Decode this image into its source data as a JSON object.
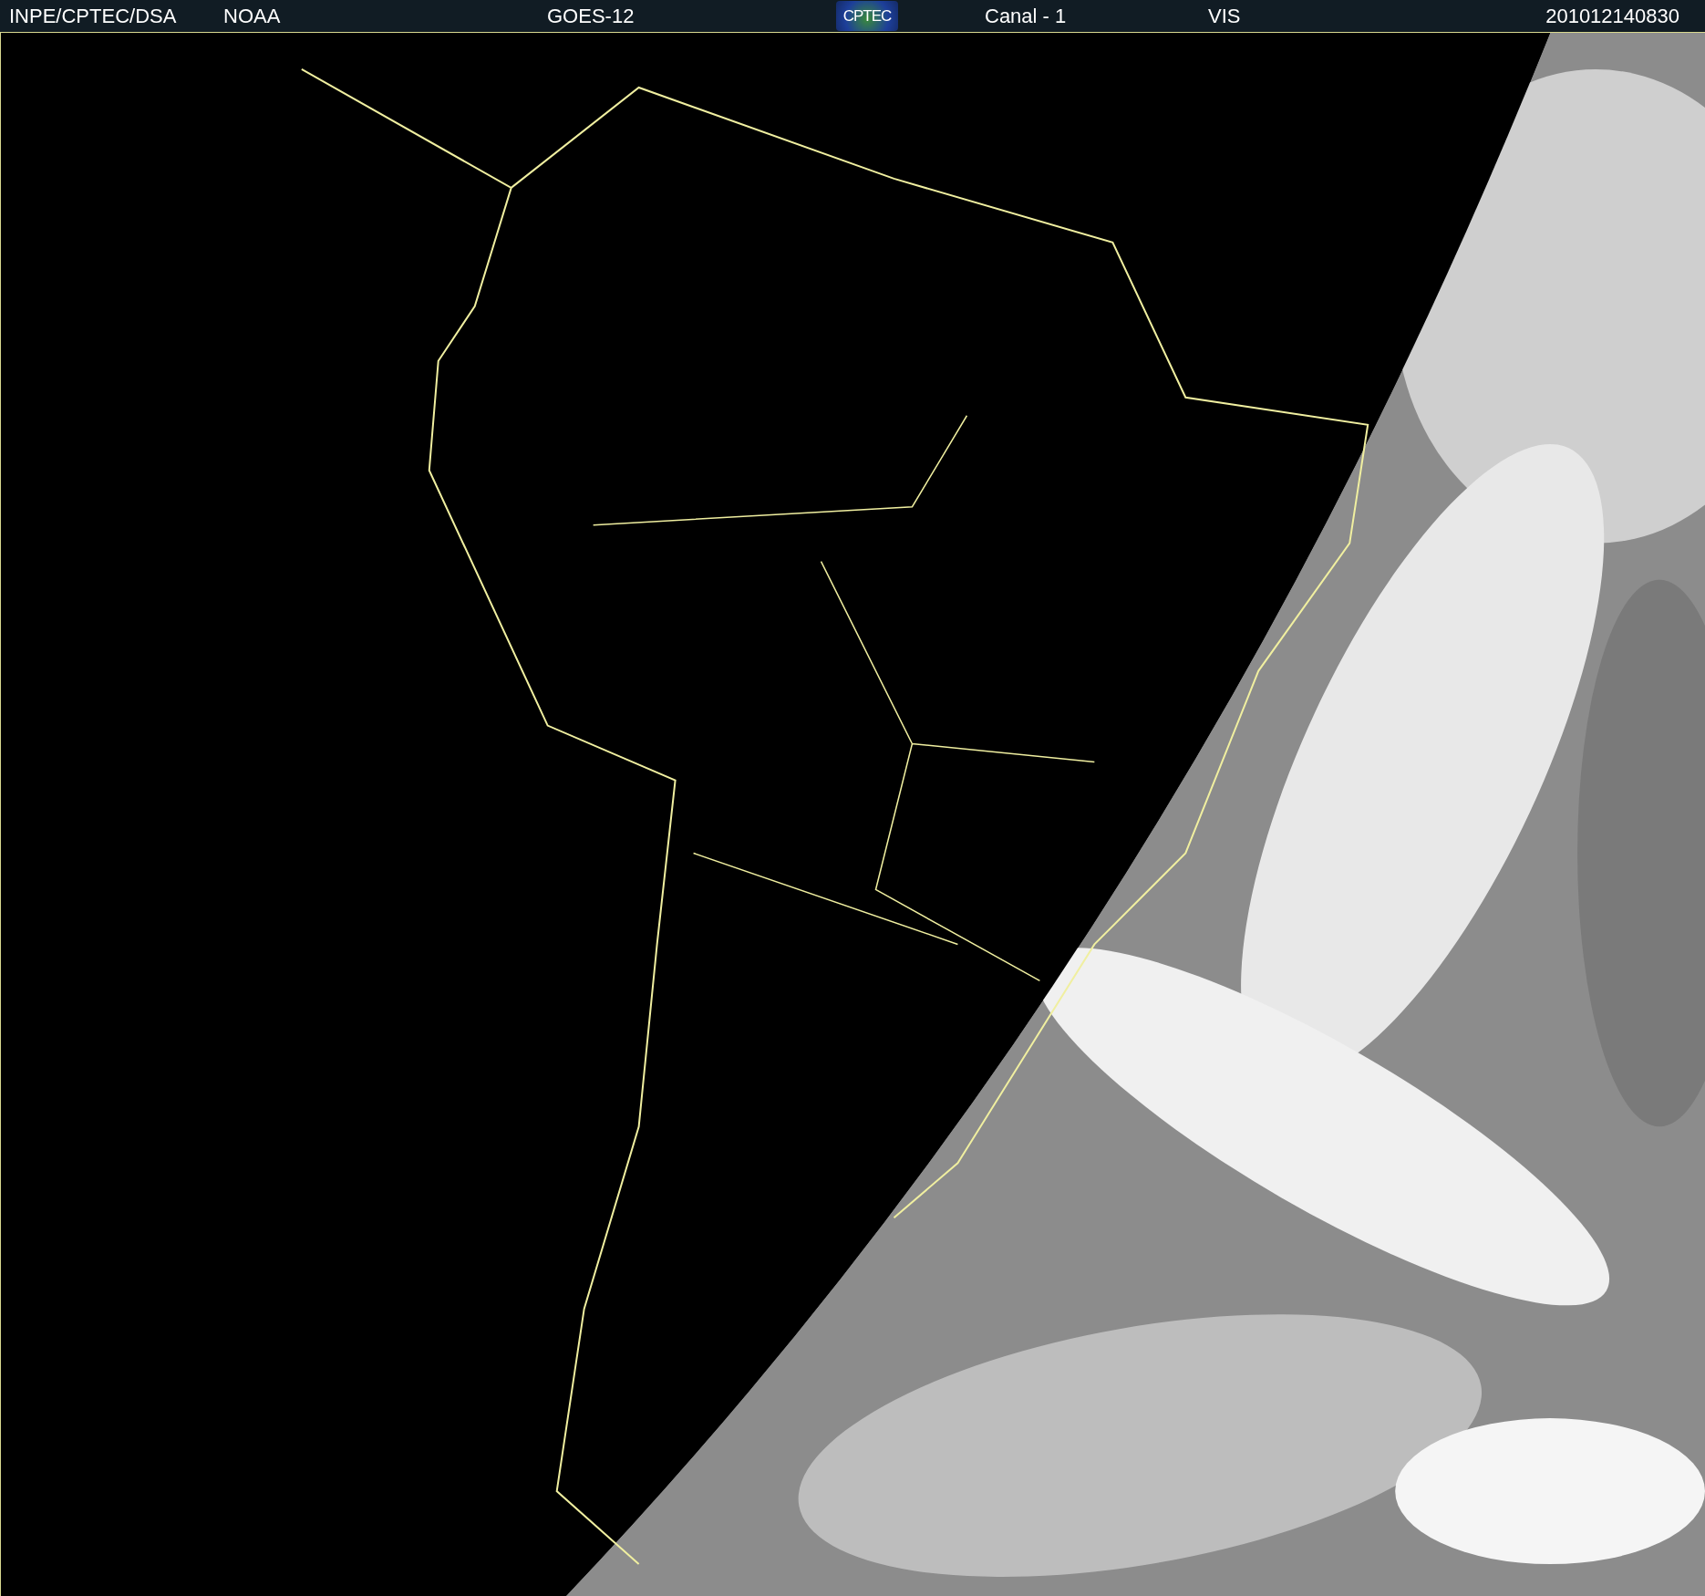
{
  "header": {
    "items": [
      {
        "kind": "text",
        "text": "INPE/CPTEC/DSA"
      },
      {
        "kind": "text",
        "text": "NOAA"
      },
      {
        "kind": "text",
        "text": "GOES-12"
      },
      {
        "kind": "logo",
        "text": "CPTEC"
      },
      {
        "kind": "text",
        "text": "Canal - 1"
      },
      {
        "kind": "text",
        "text": "VIS"
      },
      {
        "kind": "text",
        "text": "201012140830"
      }
    ]
  }
}
